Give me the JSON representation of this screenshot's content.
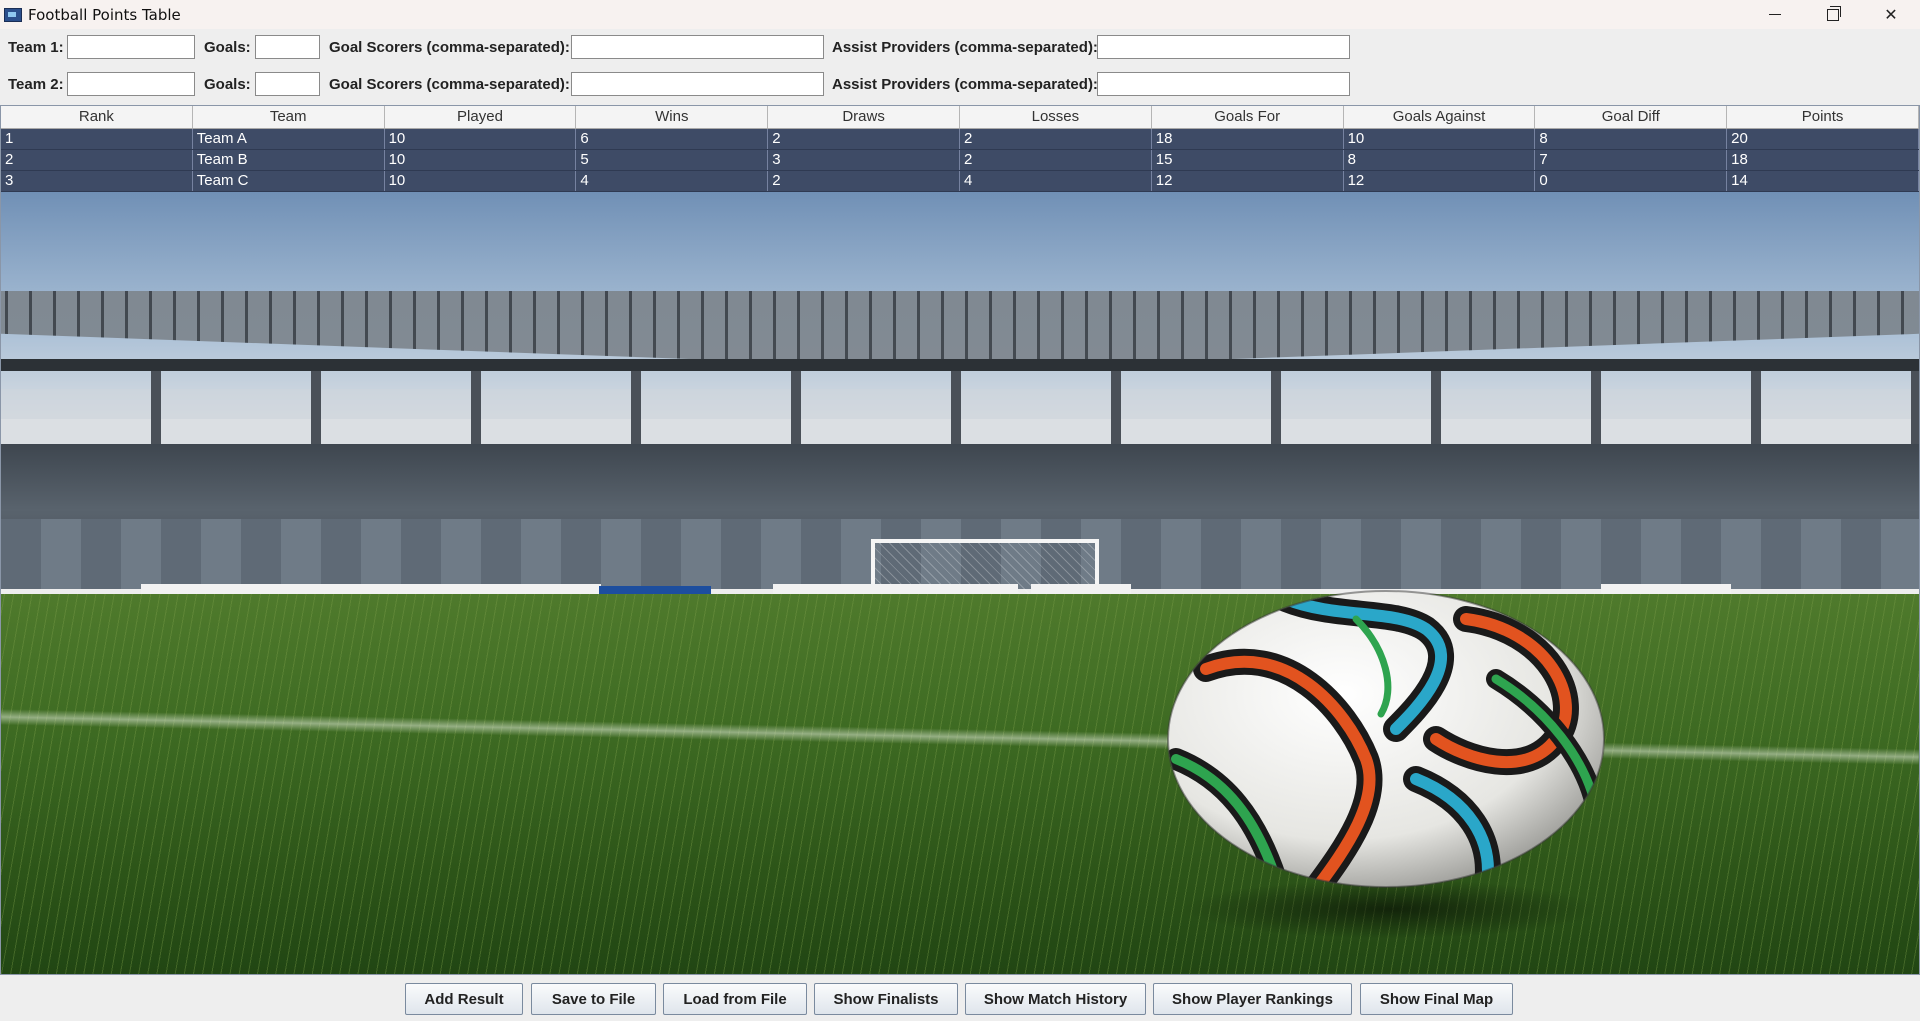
{
  "window": {
    "title": "Football Points Table"
  },
  "form": {
    "team1_label": "Team 1:",
    "team2_label": "Team 2:",
    "goals_label": "Goals:",
    "scorers_label": "Goal Scorers (comma-separated):",
    "assists_label": "Assist Providers (comma-separated):",
    "team1_value": "",
    "team2_value": "",
    "goals1_value": "",
    "goals2_value": "",
    "scorers1_value": "",
    "scorers2_value": "",
    "assists1_value": "",
    "assists2_value": ""
  },
  "table": {
    "headers": [
      "Rank",
      "Team",
      "Played",
      "Wins",
      "Draws",
      "Losses",
      "Goals For",
      "Goals Against",
      "Goal Diff",
      "Points"
    ],
    "rows": [
      [
        "1",
        "Team A",
        "10",
        "6",
        "2",
        "2",
        "18",
        "10",
        "8",
        "20"
      ],
      [
        "2",
        "Team B",
        "10",
        "5",
        "3",
        "2",
        "15",
        "8",
        "7",
        "18"
      ],
      [
        "3",
        "Team C",
        "10",
        "4",
        "2",
        "4",
        "12",
        "12",
        "0",
        "14"
      ]
    ],
    "selection_color": "#3e4b66"
  },
  "buttons": {
    "add_result": "Add Result",
    "save_file": "Save to File",
    "load_file": "Load from File",
    "show_finalists": "Show Finalists",
    "match_history": "Show Match History",
    "player_rankings": "Show Player Rankings",
    "final_map": "Show Final Map"
  },
  "icons": {
    "app": "app-window-icon",
    "minimize": "minimize-icon",
    "maximize": "restore-icon",
    "close": "close-icon"
  }
}
